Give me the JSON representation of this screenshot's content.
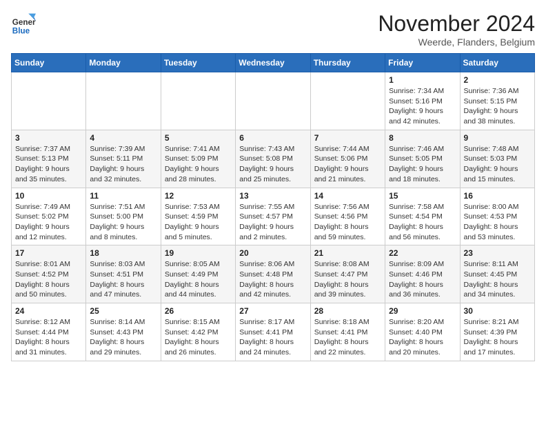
{
  "logo": {
    "general": "General",
    "blue": "Blue"
  },
  "title": "November 2024",
  "location": "Weerde, Flanders, Belgium",
  "days_of_week": [
    "Sunday",
    "Monday",
    "Tuesday",
    "Wednesday",
    "Thursday",
    "Friday",
    "Saturday"
  ],
  "weeks": [
    [
      {
        "day": "",
        "info": ""
      },
      {
        "day": "",
        "info": ""
      },
      {
        "day": "",
        "info": ""
      },
      {
        "day": "",
        "info": ""
      },
      {
        "day": "",
        "info": ""
      },
      {
        "day": "1",
        "info": "Sunrise: 7:34 AM\nSunset: 5:16 PM\nDaylight: 9 hours and 42 minutes."
      },
      {
        "day": "2",
        "info": "Sunrise: 7:36 AM\nSunset: 5:15 PM\nDaylight: 9 hours and 38 minutes."
      }
    ],
    [
      {
        "day": "3",
        "info": "Sunrise: 7:37 AM\nSunset: 5:13 PM\nDaylight: 9 hours and 35 minutes."
      },
      {
        "day": "4",
        "info": "Sunrise: 7:39 AM\nSunset: 5:11 PM\nDaylight: 9 hours and 32 minutes."
      },
      {
        "day": "5",
        "info": "Sunrise: 7:41 AM\nSunset: 5:09 PM\nDaylight: 9 hours and 28 minutes."
      },
      {
        "day": "6",
        "info": "Sunrise: 7:43 AM\nSunset: 5:08 PM\nDaylight: 9 hours and 25 minutes."
      },
      {
        "day": "7",
        "info": "Sunrise: 7:44 AM\nSunset: 5:06 PM\nDaylight: 9 hours and 21 minutes."
      },
      {
        "day": "8",
        "info": "Sunrise: 7:46 AM\nSunset: 5:05 PM\nDaylight: 9 hours and 18 minutes."
      },
      {
        "day": "9",
        "info": "Sunrise: 7:48 AM\nSunset: 5:03 PM\nDaylight: 9 hours and 15 minutes."
      }
    ],
    [
      {
        "day": "10",
        "info": "Sunrise: 7:49 AM\nSunset: 5:02 PM\nDaylight: 9 hours and 12 minutes."
      },
      {
        "day": "11",
        "info": "Sunrise: 7:51 AM\nSunset: 5:00 PM\nDaylight: 9 hours and 8 minutes."
      },
      {
        "day": "12",
        "info": "Sunrise: 7:53 AM\nSunset: 4:59 PM\nDaylight: 9 hours and 5 minutes."
      },
      {
        "day": "13",
        "info": "Sunrise: 7:55 AM\nSunset: 4:57 PM\nDaylight: 9 hours and 2 minutes."
      },
      {
        "day": "14",
        "info": "Sunrise: 7:56 AM\nSunset: 4:56 PM\nDaylight: 8 hours and 59 minutes."
      },
      {
        "day": "15",
        "info": "Sunrise: 7:58 AM\nSunset: 4:54 PM\nDaylight: 8 hours and 56 minutes."
      },
      {
        "day": "16",
        "info": "Sunrise: 8:00 AM\nSunset: 4:53 PM\nDaylight: 8 hours and 53 minutes."
      }
    ],
    [
      {
        "day": "17",
        "info": "Sunrise: 8:01 AM\nSunset: 4:52 PM\nDaylight: 8 hours and 50 minutes."
      },
      {
        "day": "18",
        "info": "Sunrise: 8:03 AM\nSunset: 4:51 PM\nDaylight: 8 hours and 47 minutes."
      },
      {
        "day": "19",
        "info": "Sunrise: 8:05 AM\nSunset: 4:49 PM\nDaylight: 8 hours and 44 minutes."
      },
      {
        "day": "20",
        "info": "Sunrise: 8:06 AM\nSunset: 4:48 PM\nDaylight: 8 hours and 42 minutes."
      },
      {
        "day": "21",
        "info": "Sunrise: 8:08 AM\nSunset: 4:47 PM\nDaylight: 8 hours and 39 minutes."
      },
      {
        "day": "22",
        "info": "Sunrise: 8:09 AM\nSunset: 4:46 PM\nDaylight: 8 hours and 36 minutes."
      },
      {
        "day": "23",
        "info": "Sunrise: 8:11 AM\nSunset: 4:45 PM\nDaylight: 8 hours and 34 minutes."
      }
    ],
    [
      {
        "day": "24",
        "info": "Sunrise: 8:12 AM\nSunset: 4:44 PM\nDaylight: 8 hours and 31 minutes."
      },
      {
        "day": "25",
        "info": "Sunrise: 8:14 AM\nSunset: 4:43 PM\nDaylight: 8 hours and 29 minutes."
      },
      {
        "day": "26",
        "info": "Sunrise: 8:15 AM\nSunset: 4:42 PM\nDaylight: 8 hours and 26 minutes."
      },
      {
        "day": "27",
        "info": "Sunrise: 8:17 AM\nSunset: 4:41 PM\nDaylight: 8 hours and 24 minutes."
      },
      {
        "day": "28",
        "info": "Sunrise: 8:18 AM\nSunset: 4:41 PM\nDaylight: 8 hours and 22 minutes."
      },
      {
        "day": "29",
        "info": "Sunrise: 8:20 AM\nSunset: 4:40 PM\nDaylight: 8 hours and 20 minutes."
      },
      {
        "day": "30",
        "info": "Sunrise: 8:21 AM\nSunset: 4:39 PM\nDaylight: 8 hours and 17 minutes."
      }
    ]
  ]
}
